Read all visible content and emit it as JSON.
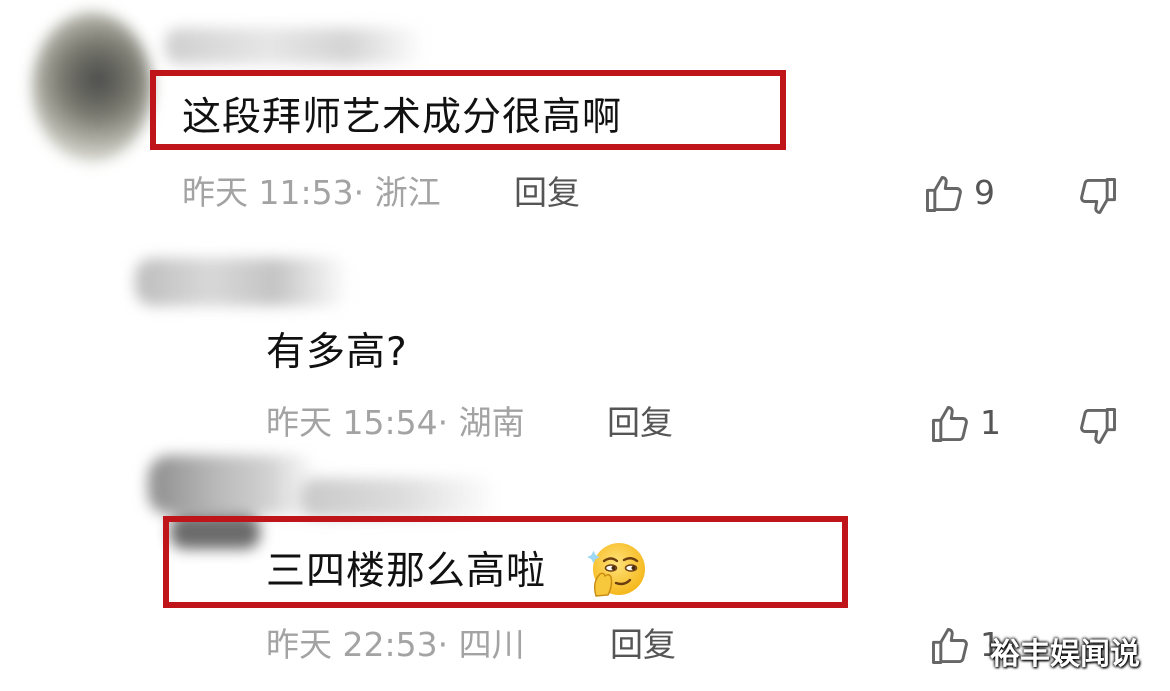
{
  "comments": [
    {
      "text": "这段拜师艺术成分很高啊",
      "meta": "昨天 11:53· 浙江",
      "reply_label": "回复",
      "likes": "9",
      "highlighted": true
    },
    {
      "text": "有多高?",
      "meta": "昨天 15:54· 湖南",
      "reply_label": "回复",
      "likes": "1",
      "highlighted": false
    },
    {
      "text": "三四楼那么高啦",
      "meta": "昨天 22:53· 四川",
      "reply_label": "回复",
      "likes": "1",
      "highlighted": true
    }
  ],
  "emoji": "smirk-emoji",
  "icons": {
    "like": "thumbs-up-icon",
    "dislike": "thumbs-down-icon"
  },
  "colors": {
    "highlight": "#c0141b",
    "meta_text": "#a3a3a3"
  },
  "watermark": "裕丰娱闻说"
}
